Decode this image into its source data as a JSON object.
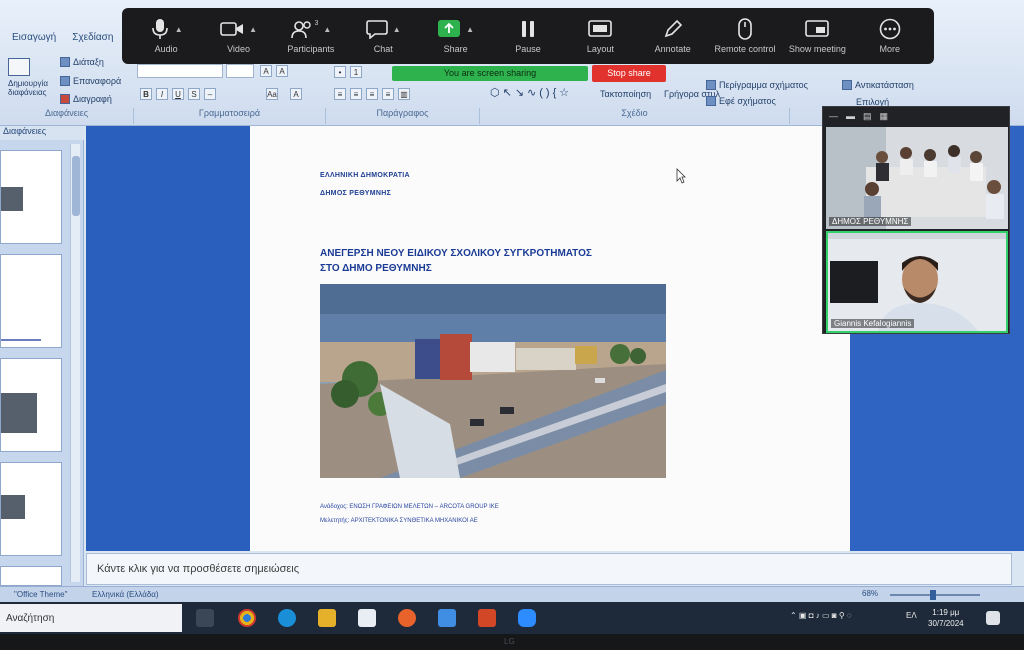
{
  "ribbon": {
    "tabs": [
      "Εισαγωγή",
      "Σχεδίαση"
    ],
    "buttons": [
      "Διάταξη",
      "Επαναφορά",
      "Διαγραφή"
    ],
    "new_slide_label": "Δημιουργία διαφάνειας",
    "shape_buttons": [
      "Τακτοποίηση",
      "Γρήγορα στυλ"
    ],
    "outline_buttons": [
      "Περίγραμμα σχήματος",
      "Εφέ σχήματος"
    ],
    "replace_label": "Αντικατάσταση",
    "select_label": "Επιλογή",
    "groups": [
      "Διαφάνειες",
      "Γραμματοσειρά",
      "Παράγραφος",
      "Σχέδιο"
    ]
  },
  "zoom_toolbar": {
    "items": [
      {
        "icon": "microphone-icon",
        "label": "Audio",
        "caret": true
      },
      {
        "icon": "video-camera-icon",
        "label": "Video",
        "caret": true
      },
      {
        "icon": "participants-icon",
        "label": "Participants",
        "count": "3",
        "caret": true
      },
      {
        "icon": "chat-icon",
        "label": "Chat",
        "caret": true
      },
      {
        "icon": "share-screen-icon",
        "label": "Share",
        "caret": true
      },
      {
        "icon": "pause-icon",
        "label": "Pause",
        "caret": false
      },
      {
        "icon": "layout-icon",
        "label": "Layout",
        "caret": false
      },
      {
        "icon": "annotate-icon",
        "label": "Annotate",
        "caret": false
      },
      {
        "icon": "remote-control-icon",
        "label": "Remote control",
        "caret": false
      },
      {
        "icon": "show-meeting-icon",
        "label": "Show meeting",
        "caret": false
      },
      {
        "icon": "more-icon",
        "label": "More",
        "caret": false
      }
    ],
    "sharing_status": "You are screen sharing",
    "stop_share_label": "Stop share",
    "colors": {
      "bar": "#1b1b1d",
      "share": "#2eb24e",
      "stop": "#e2322d"
    }
  },
  "thumbnails": {
    "header": "Διαφάνειες"
  },
  "slide": {
    "org_line1": "ΕΛΛΗΝΙΚΗ ΔΗΜΟΚΡΑΤΙΑ",
    "org_line2": "ΔΗΜΟΣ ΡΕΘΥΜΝΗΣ",
    "title_line1": "ΑΝΕΓΕΡΣΗ ΝΕΟΥ ΕΙΔΙΚΟΥ ΣΧΟΛΙΚΟΥ ΣΥΓΚΡΟΤΗΜΑΤΟΣ",
    "title_line2": "ΣΤΟ ΔΗΜΟ ΡΕΘΥΜΝΗΣ",
    "credit_line1": "Ανάδοχος: ΕΝΩΣΗ ΓΡΑΦΕΙΩΝ ΜΕΛΕΤΩΝ – ARCOTA GROUP ΙΚΕ",
    "credit_line2": "Μελετητής: ΑΡΧΙΤΕΚΤΟΝΙΚΑ ΣΥΝΘΕΤΙΚΑ ΜΗΧΑΝΙΚΟΙ ΑΕ"
  },
  "notes": {
    "placeholder": "Κάντε κλικ για να προσθέσετε σημειώσεις"
  },
  "statusbar": {
    "theme": "\"Office Theme\"",
    "language": "Ελληνικά (Ελλάδα)",
    "zoom": "68%"
  },
  "taskbar": {
    "search": "Αναζήτηση",
    "lang": "ΕΛ",
    "time": "1:19 μμ",
    "date": "30/7/2024"
  },
  "video_panel": {
    "tiles": [
      {
        "name": "ΔΗΜΟΣ ΡΕΘΥΜΝΗΣ"
      },
      {
        "name": "Giannis Kefalogiannis"
      }
    ]
  },
  "bezel": {
    "logo": "LG"
  }
}
